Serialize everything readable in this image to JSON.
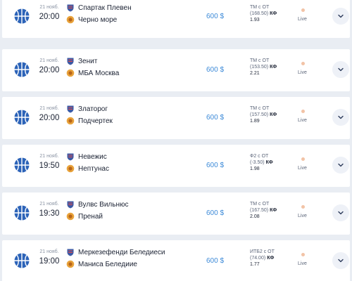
{
  "accent": "#2c63b8",
  "matches": [
    {
      "date": "21 нояб.",
      "time": "20:00",
      "team1": "Спартак Плевен",
      "team2": "Черно море",
      "team1_logo": "spartak-pleven-logo",
      "team2_logo": "cherno-more-logo",
      "amount": "600 $",
      "bet_line": "ТМ с ОТ",
      "bet_value": "(168.50)",
      "kf_label": "КФ",
      "odds": "1.93",
      "status": "Live"
    },
    {
      "date": "21 нояб.",
      "time": "20:00",
      "team1": "Зенит",
      "team2": "МБА Москва",
      "team1_logo": "zenit-logo",
      "team2_logo": "mba-moskva-logo",
      "amount": "600 $",
      "bet_line": "ТМ с ОТ",
      "bet_value": "(153.50)",
      "kf_label": "КФ",
      "odds": "2.21",
      "status": "Live"
    },
    {
      "date": "21 нояб.",
      "time": "20:00",
      "team1": "Златорог",
      "team2": "Подчертек",
      "team1_logo": "zlatorog-logo",
      "team2_logo": "podchertek-logo",
      "amount": "600 $",
      "bet_line": "ТМ с ОТ",
      "bet_value": "(157.50)",
      "kf_label": "КФ",
      "odds": "1.89",
      "status": "Live"
    },
    {
      "date": "21 нояб.",
      "time": "19:50",
      "team1": "Невежис",
      "team2": "Нептунас",
      "team1_logo": "nevezis-logo",
      "team2_logo": "neptunas-logo",
      "amount": "600 $",
      "bet_line": "Ф2 с ОТ",
      "bet_value": "(-3.50)",
      "kf_label": "КФ",
      "odds": "1.98",
      "status": "Live"
    },
    {
      "date": "21 нояб.",
      "time": "19:30",
      "team1": "Вулвс Вильнюс",
      "team2": "Пренай",
      "team1_logo": "wolves-vilnius-logo",
      "team2_logo": "prenai-logo",
      "amount": "600 $",
      "bet_line": "ТМ с ОТ",
      "bet_value": "(167.50)",
      "kf_label": "КФ",
      "odds": "2.08",
      "status": "Live"
    },
    {
      "date": "21 нояб.",
      "time": "19:00",
      "team1": "Меркезефенди Беледиеси",
      "team2": "Маниса Беледиие",
      "team1_logo": "merkezefendi-logo",
      "team2_logo": "manisa-logo",
      "amount": "600 $",
      "bet_line": "ИТБ2 с ОТ",
      "bet_value": "(74.00)",
      "kf_label": "КФ",
      "odds": "1.77",
      "status": "Live"
    }
  ]
}
